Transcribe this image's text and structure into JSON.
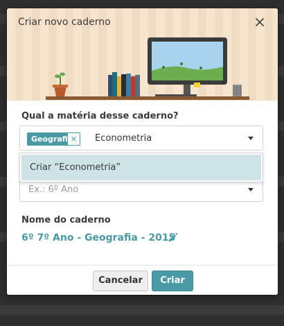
{
  "dialog": {
    "title": "Criar novo caderno",
    "close_icon": "close-icon"
  },
  "subject": {
    "label": "Qual a matéria desse caderno?",
    "selected_tag": "Geografia",
    "typed_text": "Econometria",
    "dropdown_option": "Criar “Econometria”"
  },
  "grade": {
    "placeholder": "Ex.: 6º Ano"
  },
  "notebook_name": {
    "label": "Nome do caderno",
    "value": "6º 7º Ano - Geografia - 2015",
    "edit_icon": "pencil-icon"
  },
  "footer": {
    "cancel_label": "Cancelar",
    "create_label": "Criar"
  },
  "colors": {
    "accent": "#4a9aa5",
    "dropdown_highlight": "#cde3e6",
    "hero_background": "#f6e4cf"
  }
}
